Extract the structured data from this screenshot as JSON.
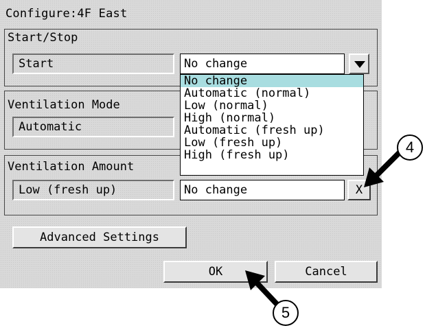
{
  "dialog": {
    "title": "Configure:4F East"
  },
  "start_stop": {
    "group_label": "Start/Stop",
    "current_value": "Start",
    "select_value": "No change",
    "options": [
      "No change",
      "Automatic (normal)",
      "Low (normal)",
      "High (normal)",
      "Automatic (fresh up)",
      "Low (fresh up)",
      "High (fresh up)"
    ],
    "highlighted_option_index": 0
  },
  "ventilation_mode": {
    "group_label": "Ventilation Mode",
    "current_value": "Automatic"
  },
  "ventilation_amount": {
    "group_label": "Ventilation Amount",
    "current_value": "Low (fresh up)",
    "select_value": "No change",
    "clear_label": "X"
  },
  "buttons": {
    "advanced": "Advanced Settings",
    "ok": "OK",
    "cancel": "Cancel"
  },
  "callouts": {
    "four": "4",
    "five": "5"
  },
  "colors": {
    "panel_bg": "#d9d9d9",
    "highlight": "#a8dde0"
  },
  "icons": {
    "dropdown": "triangle-down-icon",
    "callout_arrow": "arrow-icon"
  }
}
